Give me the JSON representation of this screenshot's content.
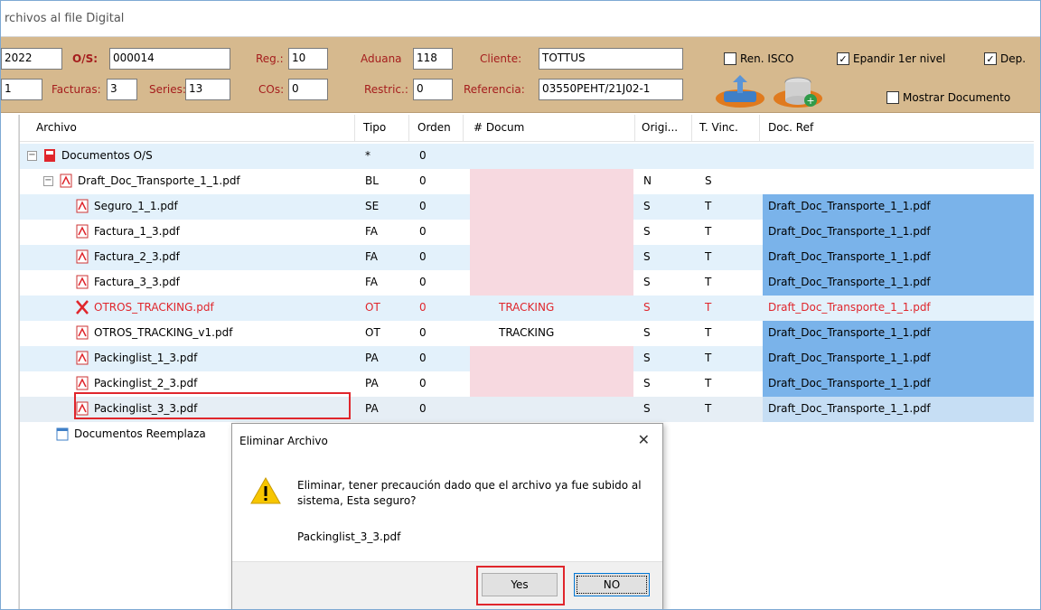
{
  "window": {
    "title": "rchivos al file Digital"
  },
  "toolbar": {
    "year": "2022",
    "os_label": "O/S:",
    "os_value": "000014",
    "reg_label": "Reg.:",
    "reg_value": "10",
    "aduana_label": "Aduana",
    "aduana_value": "118",
    "cliente_label": "Cliente:",
    "cliente_value": "TOTTUS",
    "ren_isco_label": "Ren. ISCO",
    "ren_isco_checked": false,
    "expandir_label": "Epandir 1er nivel",
    "expandir_checked": true,
    "dep_label": "Dep.",
    "dep_checked": true,
    "row2_first": "1",
    "facturas_label": "Facturas:",
    "facturas_value": "3",
    "series_label": "Series:",
    "series_value": "13",
    "cos_label": "COs:",
    "cos_value": "0",
    "restric_label": "Restric.:",
    "restric_value": "0",
    "referencia_label": "Referencia:",
    "referencia_value": "03550PEHT/21J02-1",
    "mostrar_label": "Mostrar Documento",
    "mostrar_checked": false,
    "icons": [
      "upload-scanner-icon",
      "database-add-icon"
    ]
  },
  "grid": {
    "headers": {
      "archivo": "Archivo",
      "tipo": "Tipo",
      "orden": "Orden",
      "ndocum": "# Docum",
      "orig": "Origi...",
      "tvinc": "T. Vinc.",
      "docref": "Doc. Ref"
    },
    "rows": [
      {
        "name": "Documentos O/S",
        "tipo": "*",
        "orden": "0",
        "ndocum": "",
        "orig": "",
        "tvinc": "",
        "docref": ""
      },
      {
        "name": "Draft_Doc_Transporte_1_1.pdf",
        "tipo": "BL",
        "orden": "0",
        "ndocum": "",
        "orig": "N",
        "tvinc": "S",
        "docref": ""
      },
      {
        "name": "Seguro_1_1.pdf",
        "tipo": "SE",
        "orden": "0",
        "ndocum": "",
        "orig": "S",
        "tvinc": "T",
        "docref": "Draft_Doc_Transporte_1_1.pdf"
      },
      {
        "name": "Factura_1_3.pdf",
        "tipo": "FA",
        "orden": "0",
        "ndocum": "",
        "orig": "S",
        "tvinc": "T",
        "docref": "Draft_Doc_Transporte_1_1.pdf"
      },
      {
        "name": "Factura_2_3.pdf",
        "tipo": "FA",
        "orden": "0",
        "ndocum": "",
        "orig": "S",
        "tvinc": "T",
        "docref": "Draft_Doc_Transporte_1_1.pdf"
      },
      {
        "name": "Factura_3_3.pdf",
        "tipo": "FA",
        "orden": "0",
        "ndocum": "",
        "orig": "S",
        "tvinc": "T",
        "docref": "Draft_Doc_Transporte_1_1.pdf"
      },
      {
        "name": "OTROS_TRACKING.pdf",
        "tipo": "OT",
        "orden": "0",
        "ndocum": "TRACKING",
        "orig": "S",
        "tvinc": "T",
        "docref": "Draft_Doc_Transporte_1_1.pdf"
      },
      {
        "name": "OTROS_TRACKING_v1.pdf",
        "tipo": "OT",
        "orden": "0",
        "ndocum": "TRACKING",
        "orig": "S",
        "tvinc": "T",
        "docref": "Draft_Doc_Transporte_1_1.pdf"
      },
      {
        "name": "Packinglist_1_3.pdf",
        "tipo": "PA",
        "orden": "0",
        "ndocum": "",
        "orig": "S",
        "tvinc": "T",
        "docref": "Draft_Doc_Transporte_1_1.pdf"
      },
      {
        "name": "Packinglist_2_3.pdf",
        "tipo": "PA",
        "orden": "0",
        "ndocum": "",
        "orig": "S",
        "tvinc": "T",
        "docref": "Draft_Doc_Transporte_1_1.pdf"
      },
      {
        "name": "Packinglist_3_3.pdf",
        "tipo": "PA",
        "orden": "0",
        "ndocum": "",
        "orig": "S",
        "tvinc": "T",
        "docref": "Draft_Doc_Transporte_1_1.pdf"
      },
      {
        "name": "Documentos Reemplaza"
      }
    ]
  },
  "dialog": {
    "title": "Eliminar Archivo",
    "close": "✕",
    "message": "Eliminar, tener precaución dado que el archivo ya fue subido al sistema, Esta seguro?",
    "filename": "Packinglist_3_3.pdf",
    "yes": "Yes",
    "no": "NO",
    "icon": "warning-icon"
  },
  "colors": {
    "toolbar": "#d6b98e",
    "row_alt": "#e3f1fb",
    "pink": "#f7d9e0",
    "ref_blue": "#7ab3ea",
    "red_text": "#e0262c"
  }
}
